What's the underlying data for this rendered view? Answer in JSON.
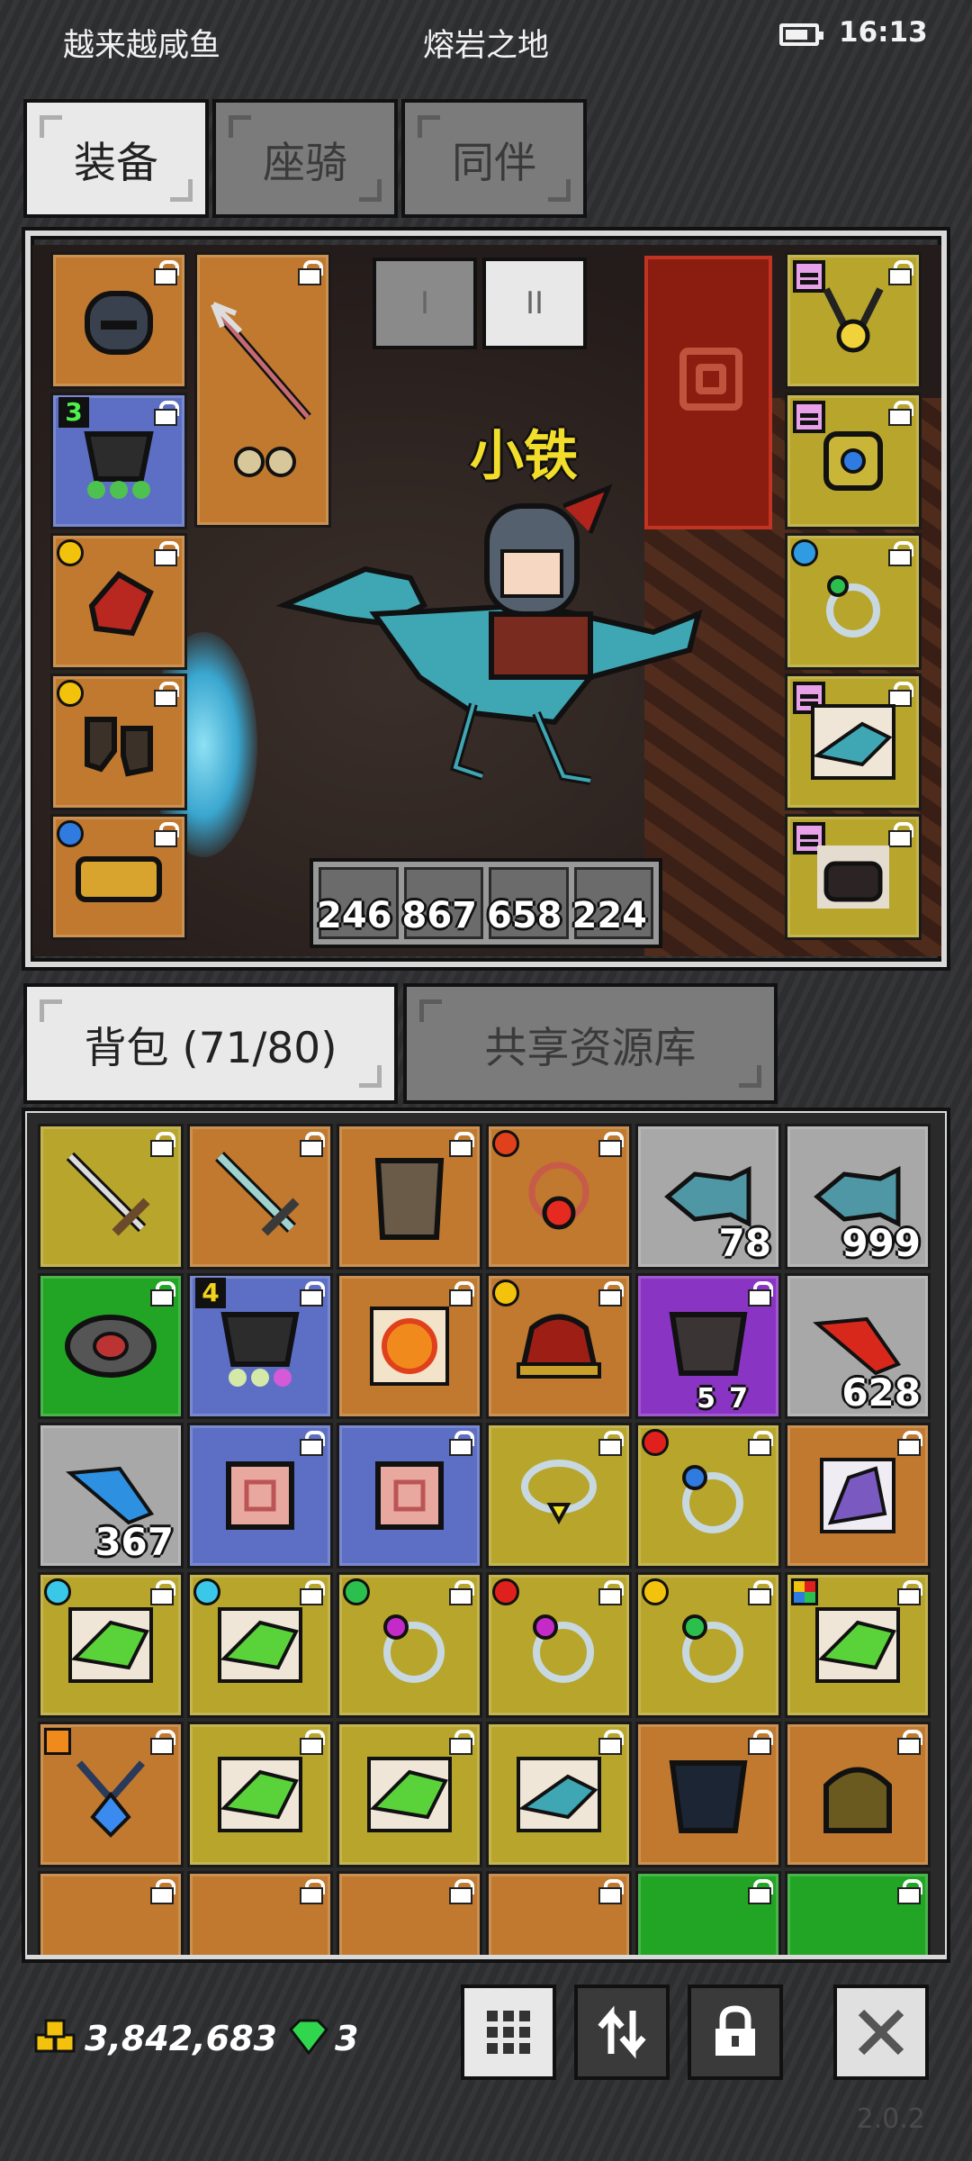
{
  "status_bar": {
    "nickname": "越来越咸鱼",
    "map_name": "熔岩之地",
    "time": "16:13"
  },
  "top_tabs": [
    {
      "label": "装备",
      "active": true
    },
    {
      "label": "座骑",
      "active": false
    },
    {
      "label": "同伴",
      "active": false
    }
  ],
  "scene": {
    "character_name": "小铁",
    "tier_buttons": [
      "I",
      "II"
    ],
    "potions": [
      "246",
      "867",
      "658",
      "224"
    ]
  },
  "bag_tabs": [
    {
      "label": "背包 (71/80)",
      "active": true
    },
    {
      "label": "共享资源库",
      "active": false
    }
  ],
  "bag_counts": {
    "fish_1": "78",
    "fish_2": "999",
    "red_feather": "628",
    "blue_feather": "367",
    "item_a": "5",
    "item_b": "7"
  },
  "equipment_badges": {
    "armor_level": "3",
    "bag_armor_level": "4"
  },
  "currency": {
    "gold": "3,842,683",
    "diamonds": "3"
  },
  "version": "2.0.2",
  "colors": {
    "orange": "#c0792e",
    "yellow": "#b7a52c",
    "blue": "#5d6fc4",
    "green": "#22a524",
    "purple": "#8a34c4",
    "gray": "#a8a8a8"
  }
}
